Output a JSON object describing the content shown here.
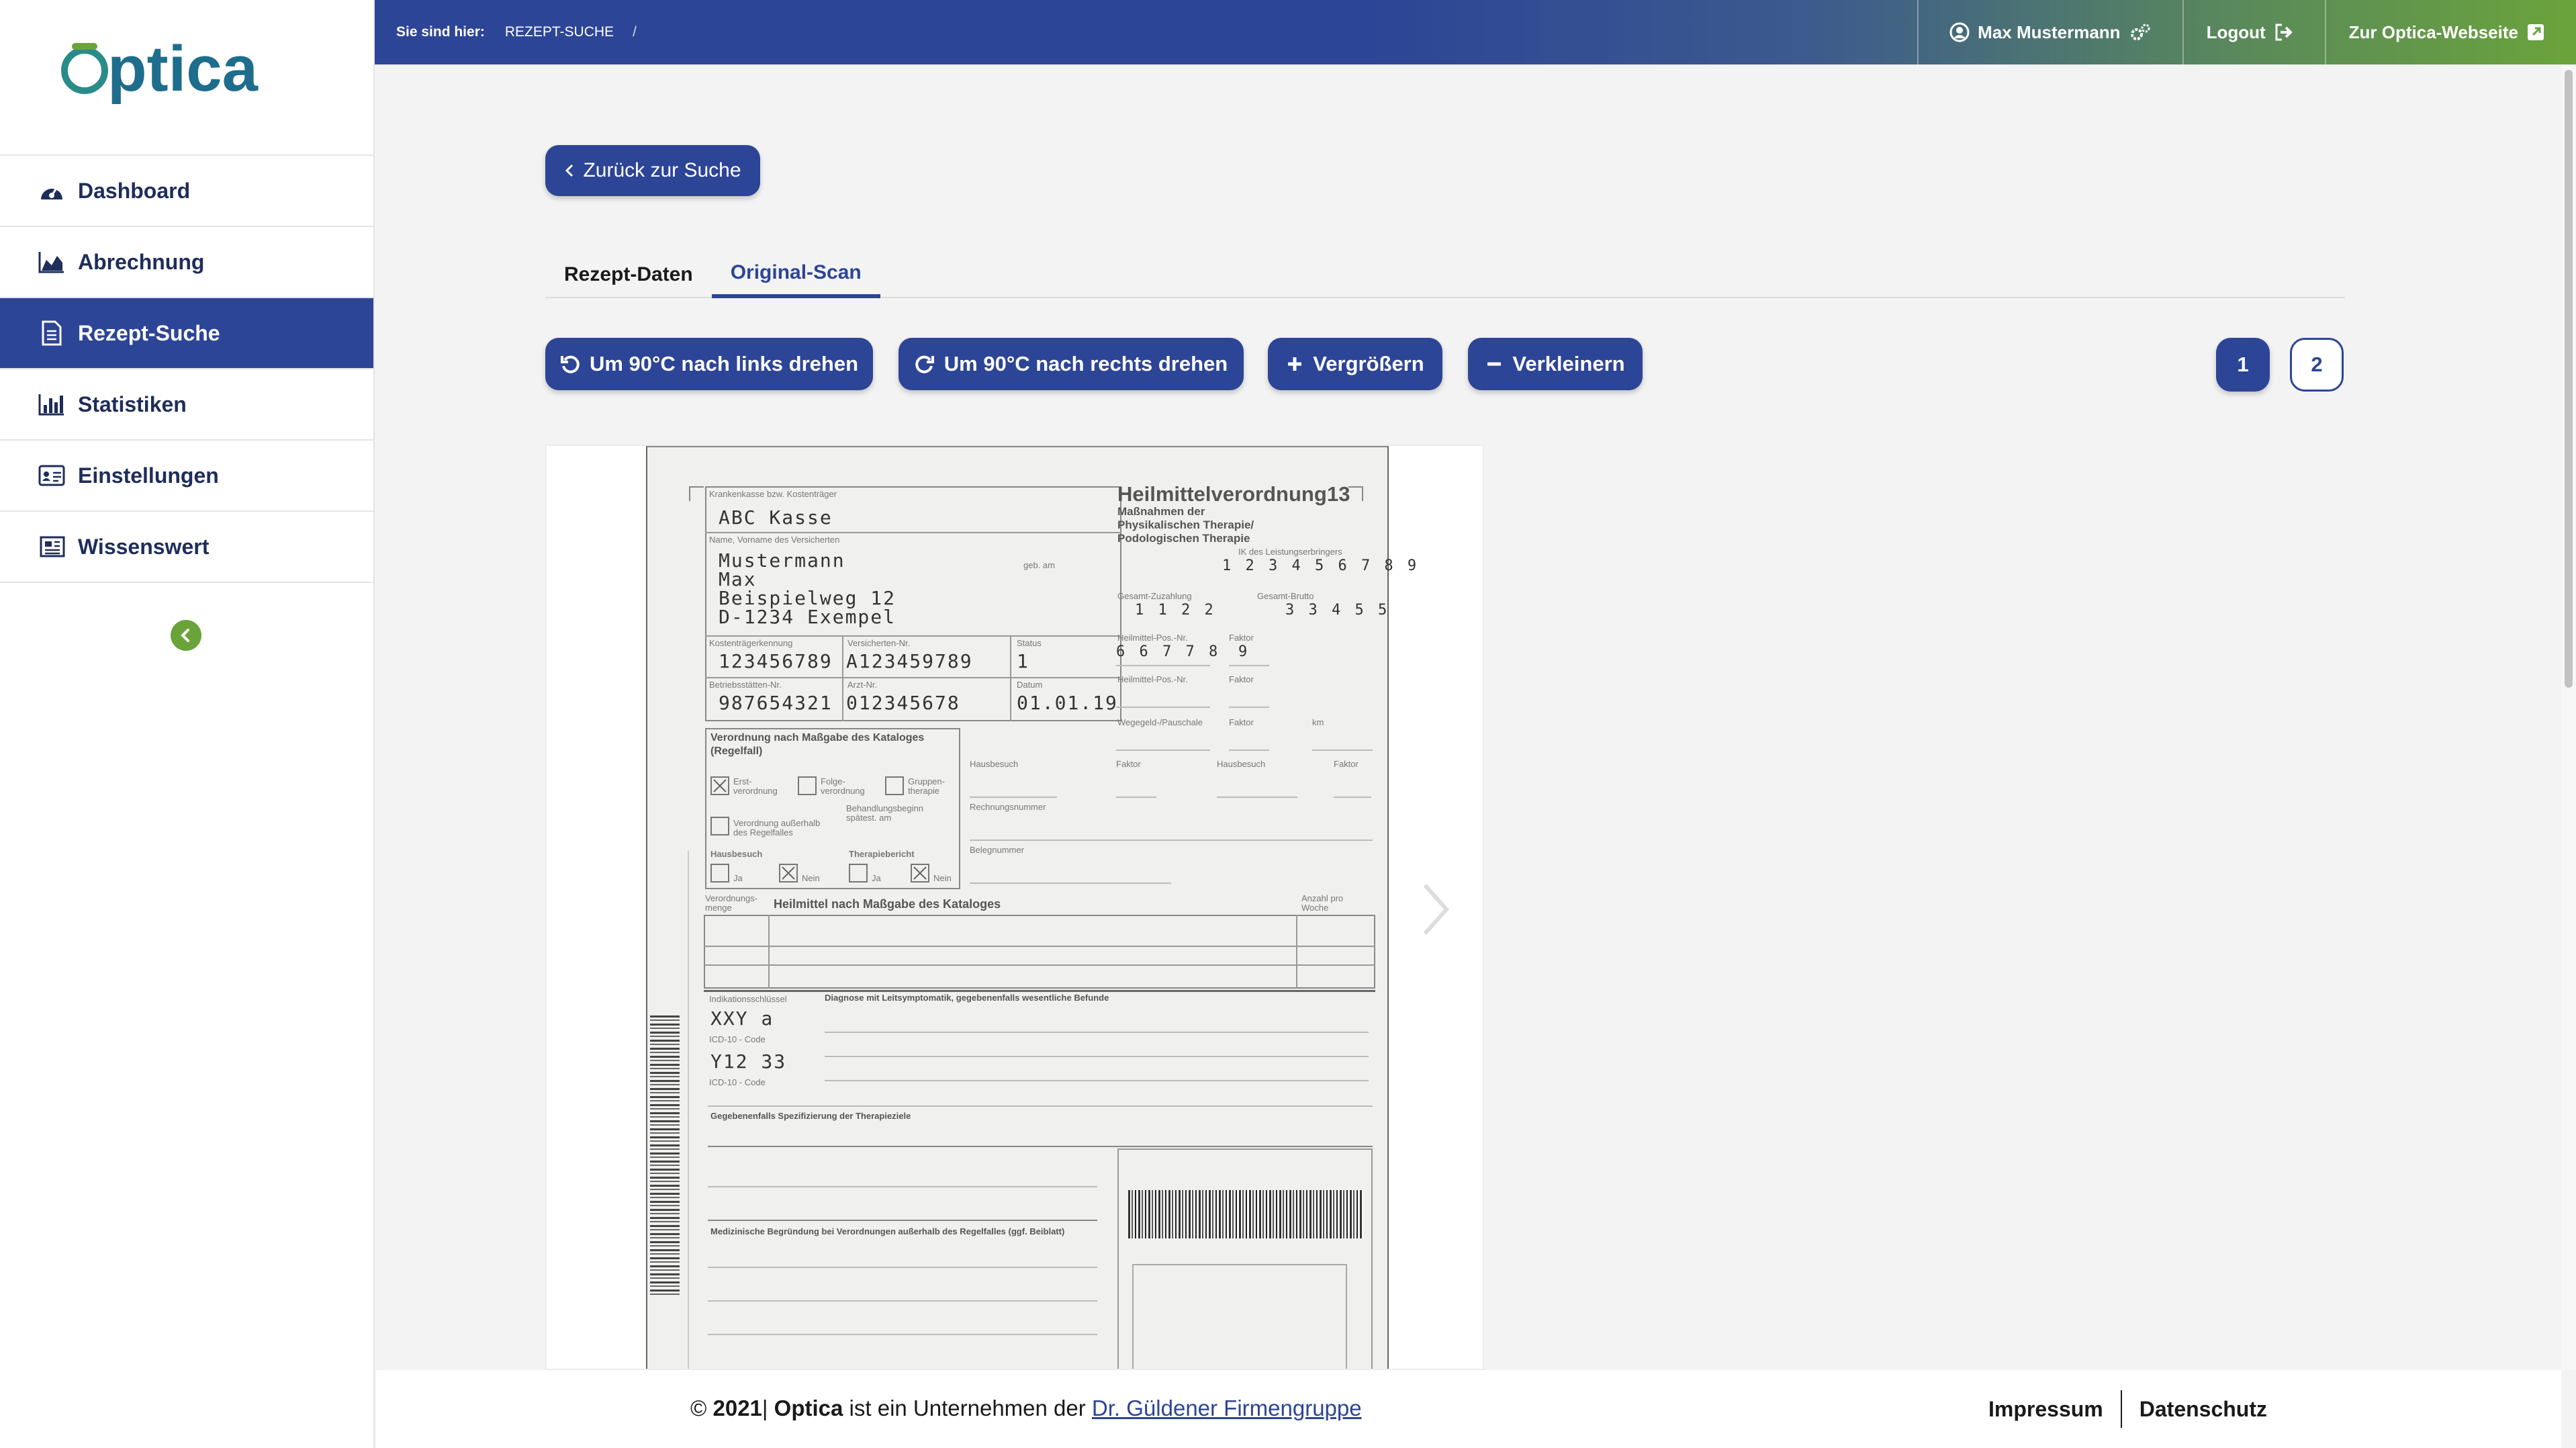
{
  "brand": {
    "logo_text": "Optica",
    "accent": "#2d4596",
    "green": "#6ba33b"
  },
  "sidebar": {
    "items": [
      {
        "label": "Dashboard",
        "icon": "dashboard-icon"
      },
      {
        "label": "Abrechnung",
        "icon": "area-chart-icon"
      },
      {
        "label": "Rezept-Suche",
        "icon": "document-icon",
        "active": true
      },
      {
        "label": "Statistiken",
        "icon": "bar-chart-icon"
      },
      {
        "label": "Einstellungen",
        "icon": "id-card-icon"
      },
      {
        "label": "Wissenswert",
        "icon": "newspaper-icon"
      }
    ],
    "collapse_icon": "chevron-left-circle-icon"
  },
  "topbar": {
    "breadcrumb_label": "Sie sind hier:",
    "breadcrumb_current": "REZEPT-SUCHE",
    "breadcrumb_sep": "/",
    "user_name": "Max Mustermann",
    "logout_label": "Logout",
    "website_label": "Zur Optica-Webseite"
  },
  "main": {
    "back_label": "Zurück zur Suche",
    "tabs": [
      {
        "label": "Rezept-Daten",
        "active": false
      },
      {
        "label": "Original-Scan",
        "active": true
      }
    ],
    "toolbar": {
      "rotate_left": "Um 90°C nach links drehen",
      "rotate_right": "Um 90°C nach rechts drehen",
      "zoom_in": "Vergrößern",
      "zoom_out": "Verkleinern"
    },
    "pages": [
      "1",
      "2"
    ],
    "current_page": "1"
  },
  "scan": {
    "title": "Heilmittelverordnung",
    "title_no": "13",
    "subtitle1": "Maßnahmen der",
    "subtitle2": "Physikalischen Therapie/",
    "subtitle3": "Podologischen Therapie",
    "ik_label": "IK des Leistungserbringers",
    "ik": "1 2 3 4 5 6 7 8 9",
    "lbl_kasse": "Krankenkasse bzw. Kostenträger",
    "kasse": "ABC Kasse",
    "lbl_name": "Name, Vorname des Versicherten",
    "lbl_geb": "geb. am",
    "name1": "Mustermann",
    "name2": "Max",
    "street": "Beispielweg 12",
    "city": "D-1234 Exempel",
    "lbl_ktk": "Kostenträgerkennung",
    "lbl_vnr": "Versicherten-Nr.",
    "lbl_status": "Status",
    "ktk": "123456789",
    "vnr": "A123459789",
    "status": "1",
    "lbl_bsnr": "Betriebsstätten-Nr.",
    "lbl_arzt": "Arzt-Nr.",
    "lbl_datum": "Datum",
    "bsnr": "987654321",
    "arzt": "012345678",
    "datum": "01.01.19",
    "lbl_zuzahlung": "Gesamt-Zuzahlung",
    "zuzahlung": "1 1 2 2",
    "lbl_brutto": "Gesamt-Brutto",
    "brutto": "3 3 4 5 5",
    "lbl_pos": "Heilmittel-Pos.-Nr.",
    "lbl_faktor": "Faktor",
    "pos": "6 6 7 7 8",
    "faktor": "9",
    "lbl_pos2": "Heilmittel-Pos.-Nr.",
    "lbl_faktor2": "Faktor",
    "lbl_wegegeld": "Wegegeld-/Pauschale",
    "lbl_faktor3": "Faktor",
    "lbl_km": "km",
    "lbl_verordnung": "Verordnung nach Maßgabe des Kataloges",
    "lbl_regelfall": "(Regelfall)",
    "lbl_erst": "Erst-",
    "lbl_erst2": "verordnung",
    "lbl_folge": "Folge-",
    "lbl_folge2": "verordnung",
    "lbl_gruppe": "Gruppen-",
    "lbl_gruppe2": "therapie",
    "lbl_ausserhalb": "Verordnung außerhalb",
    "lbl_ausserhalb2": "des Regelfalles",
    "lbl_beginn": "Behandlungsbeginn",
    "lbl_beginn2": "spätest. am",
    "lbl_hausbesuch": "Hausbesuch",
    "lbl_therapiebericht": "Therapiebericht",
    "lbl_ja": "Ja",
    "lbl_nein": "Nein",
    "lbl_hausbesuch2": "Hausbesuch",
    "lbl_faktor4": "Faktor",
    "lbl_hausbesuch3": "Hausbesuch",
    "lbl_faktor5": "Faktor",
    "lbl_rechnungsnummer": "Rechnungsnummer",
    "lbl_belegnummer": "Belegnummer",
    "lbl_menge": "Verordnungs-",
    "lbl_menge2": "menge",
    "lbl_heilmittel": "Heilmittel nach Maßgabe des Kataloges",
    "lbl_anzahl": "Anzahl pro",
    "lbl_anzahl2": "Woche",
    "lbl_indikation": "Indikationsschlüssel",
    "lbl_diagnose": "Diagnose mit Leitsymptomatik, gegebenenfalls wesentliche Befunde",
    "indikation": "XXY a",
    "lbl_icd": "ICD-10 - Code",
    "icd": "Y12 33",
    "lbl_icd2": "ICD-10 - Code",
    "lbl_ziel": "Gegebenenfalls Spezifizierung der Therapieziele",
    "lbl_begruendung": "Medizinische Begründung bei Verordnungen außerhalb des Regelfalles (ggf. Beiblatt)"
  },
  "footer": {
    "year": "2021",
    "copyright": "©",
    "brand": "Optica",
    "text": "ist ein Unternehmen der",
    "link": "Dr. Güldener Firmengruppe",
    "impressum": "Impressum",
    "datenschutz": "Datenschutz"
  }
}
